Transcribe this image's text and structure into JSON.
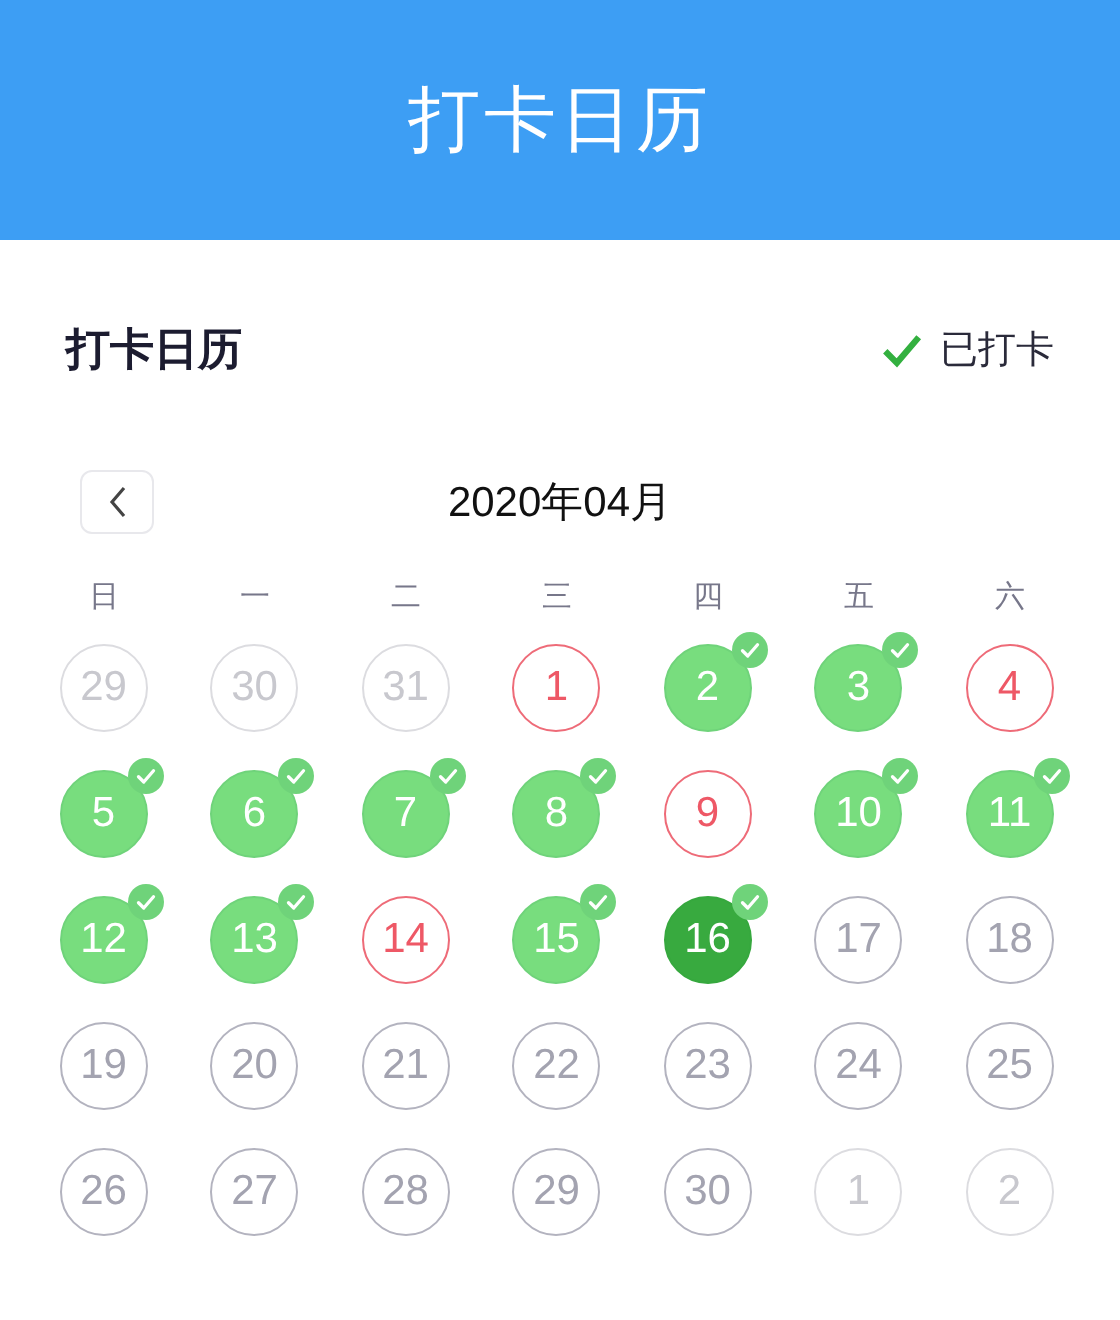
{
  "header": {
    "title": "打卡日历"
  },
  "card": {
    "title": "打卡日历",
    "legend": "已打卡"
  },
  "month": {
    "label": "2020年04月"
  },
  "weekdays": [
    "日",
    "一",
    "二",
    "三",
    "四",
    "五",
    "六"
  ],
  "days": [
    {
      "label": "29",
      "kind": "other"
    },
    {
      "label": "30",
      "kind": "other"
    },
    {
      "label": "31",
      "kind": "other"
    },
    {
      "label": "1",
      "kind": "missed"
    },
    {
      "label": "2",
      "kind": "checked"
    },
    {
      "label": "3",
      "kind": "checked"
    },
    {
      "label": "4",
      "kind": "missed"
    },
    {
      "label": "5",
      "kind": "checked"
    },
    {
      "label": "6",
      "kind": "checked"
    },
    {
      "label": "7",
      "kind": "checked"
    },
    {
      "label": "8",
      "kind": "checked"
    },
    {
      "label": "9",
      "kind": "missed"
    },
    {
      "label": "10",
      "kind": "checked"
    },
    {
      "label": "11",
      "kind": "checked"
    },
    {
      "label": "12",
      "kind": "checked"
    },
    {
      "label": "13",
      "kind": "checked"
    },
    {
      "label": "14",
      "kind": "missed"
    },
    {
      "label": "15",
      "kind": "checked"
    },
    {
      "label": "16",
      "kind": "today"
    },
    {
      "label": "17",
      "kind": "future"
    },
    {
      "label": "18",
      "kind": "future"
    },
    {
      "label": "19",
      "kind": "future"
    },
    {
      "label": "20",
      "kind": "future"
    },
    {
      "label": "21",
      "kind": "future"
    },
    {
      "label": "22",
      "kind": "future"
    },
    {
      "label": "23",
      "kind": "future"
    },
    {
      "label": "24",
      "kind": "future"
    },
    {
      "label": "25",
      "kind": "future"
    },
    {
      "label": "26",
      "kind": "future"
    },
    {
      "label": "27",
      "kind": "future"
    },
    {
      "label": "28",
      "kind": "future"
    },
    {
      "label": "29",
      "kind": "future"
    },
    {
      "label": "30",
      "kind": "future"
    },
    {
      "label": "1",
      "kind": "other"
    },
    {
      "label": "2",
      "kind": "other"
    }
  ]
}
